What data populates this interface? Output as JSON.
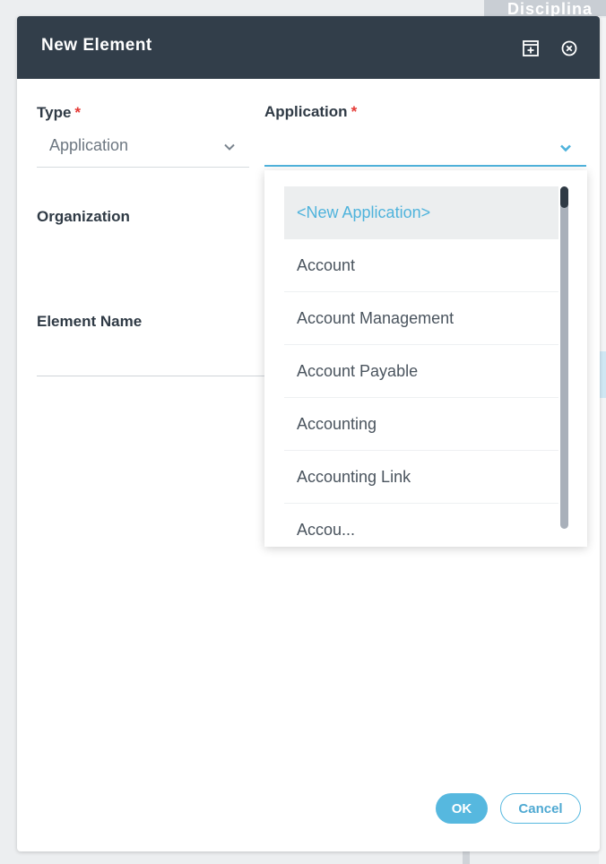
{
  "background": {
    "tab_label": "Disciplina"
  },
  "dialog": {
    "title": "New Element",
    "header_icons": [
      "maximize-icon",
      "close-circle-icon"
    ],
    "fields": {
      "type": {
        "label": "Type",
        "required_mark": "*",
        "value": "Application"
      },
      "application": {
        "label": "Application",
        "required_mark": "*",
        "value": ""
      },
      "organization": {
        "label": "Organization"
      },
      "element_name": {
        "label": "Element Name",
        "value": ""
      }
    },
    "dropdown": {
      "options": [
        "<New Application>",
        "Account",
        "Account Management",
        "Account Payable",
        "Accounting",
        "Accounting Link",
        "Accou..."
      ],
      "highlighted_index": 0
    },
    "buttons": {
      "ok": "OK",
      "cancel": "Cancel"
    }
  },
  "colors": {
    "header": "#323e4a",
    "accent": "#56b8df",
    "required": "#e53935"
  }
}
